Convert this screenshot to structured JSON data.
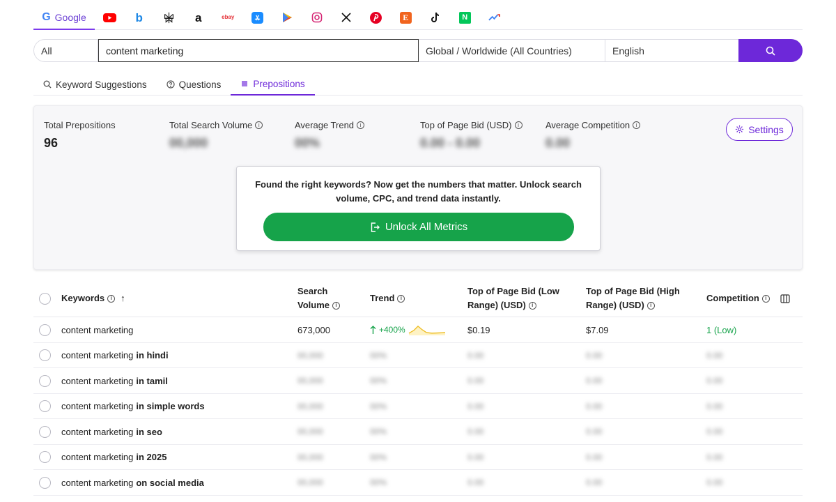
{
  "platforms": {
    "google_label": "Google",
    "ebay_label": "ebay",
    "etsy_label": "E",
    "naver_label": "N",
    "bing_label": "b",
    "amazon_label": "a"
  },
  "search": {
    "category": "All",
    "query": "content marketing",
    "country": "Global / Worldwide (All Countries)",
    "language": "English"
  },
  "tabs": [
    {
      "label": "Keyword Suggestions",
      "icon": "search-icon"
    },
    {
      "label": "Questions",
      "icon": "question-icon"
    },
    {
      "label": "Prepositions",
      "icon": "list-icon",
      "active": true
    }
  ],
  "stats": {
    "total_prepositions_label": "Total Prepositions",
    "total_prepositions_value": "96",
    "total_volume_label": "Total Search Volume",
    "total_volume_value": "00,000",
    "avg_trend_label": "Average Trend",
    "avg_trend_value": "00%",
    "top_bid_label": "Top of Page Bid (USD)",
    "top_bid_value": "0.00 - 0.00",
    "avg_comp_label": "Average Competition",
    "avg_comp_value": "0.00",
    "settings_label": "Settings"
  },
  "unlock": {
    "message": "Found the right keywords? Now get the numbers that matter. Unlock search volume, CPC, and trend data instantly.",
    "button_label": "Unlock All Metrics"
  },
  "table": {
    "headers": {
      "keywords": "Keywords",
      "sort_arrow": "↑",
      "volume_l1": "Search",
      "volume_l2": "Volume",
      "trend": "Trend",
      "low_l1": "Top of Page Bid (Low",
      "low_l2": "Range) (USD)",
      "high_l1": "Top of Page Bid (High",
      "high_l2": "Range) (USD)",
      "competition": "Competition"
    },
    "first_row": {
      "keyword": "content marketing",
      "volume": "673,000",
      "trend": "+400%",
      "bid_low": "$0.19",
      "bid_high": "$7.09",
      "competition": "1 (Low)"
    },
    "blur_placeholder": {
      "volume": "00,000",
      "trend": "00%",
      "bid": "0.00",
      "competition": "0.00"
    },
    "rows": [
      {
        "base": "content marketing",
        "suffix": "in hindi"
      },
      {
        "base": "content marketing",
        "suffix": "in tamil"
      },
      {
        "base": "content marketing",
        "suffix": "in simple words"
      },
      {
        "base": "content marketing",
        "suffix": "in seo"
      },
      {
        "base": "content marketing",
        "suffix": "in 2025"
      },
      {
        "base": "content marketing",
        "suffix": "on social media"
      }
    ]
  },
  "colors": {
    "accent": "#6d28d9",
    "success": "#16a34a",
    "trend_line": "#eab308"
  }
}
